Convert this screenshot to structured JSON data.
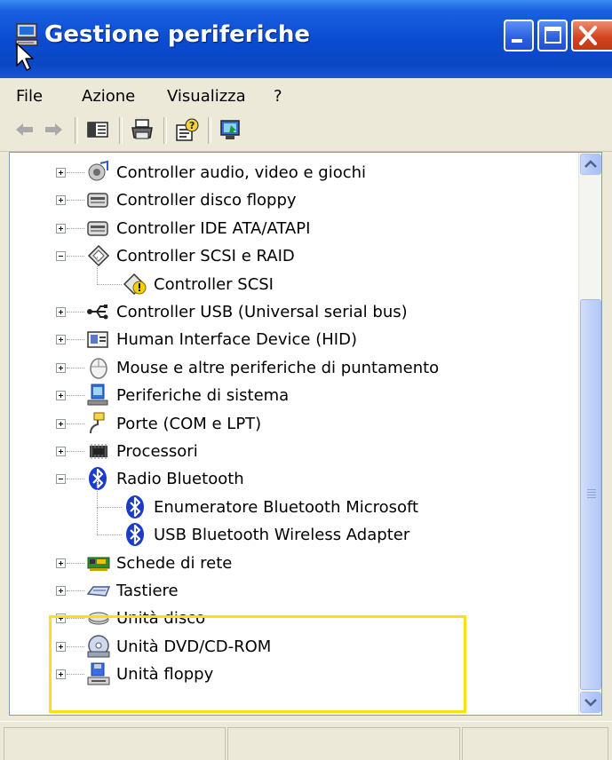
{
  "window": {
    "title": "Gestione periferiche"
  },
  "menu": [
    "File",
    "Azione",
    "Visualizza",
    "?"
  ],
  "toolbar": {
    "buttons": [
      "back-arrow-icon",
      "forward-arrow-icon",
      "show-hide-console-tree-icon",
      "print-icon",
      "help-icon",
      "properties-icon"
    ]
  },
  "tree": {
    "items": [
      {
        "label": "Controller audio, video e giochi",
        "expanded": false,
        "icon": "speaker-icon"
      },
      {
        "label": "Controller disco floppy",
        "expanded": false,
        "icon": "floppy-controller-icon"
      },
      {
        "label": "Controller IDE ATA/ATAPI",
        "expanded": false,
        "icon": "ide-controller-icon"
      },
      {
        "label": "Controller SCSI e RAID",
        "expanded": true,
        "icon": "scsi-icon"
      },
      {
        "label": "Controller SCSI",
        "child": true,
        "icon": "scsi-warning-icon"
      },
      {
        "label": "Controller USB (Universal serial bus)",
        "expanded": false,
        "icon": "usb-icon"
      },
      {
        "label": "Human Interface Device (HID)",
        "expanded": false,
        "icon": "hid-icon"
      },
      {
        "label": "Mouse e altre periferiche di puntamento",
        "expanded": false,
        "icon": "mouse-icon"
      },
      {
        "label": "Periferiche di sistema",
        "expanded": false,
        "icon": "system-device-icon"
      },
      {
        "label": "Porte (COM e LPT)",
        "expanded": false,
        "icon": "port-icon"
      },
      {
        "label": "Processori",
        "expanded": false,
        "icon": "processor-icon"
      },
      {
        "label": "Radio Bluetooth",
        "expanded": true,
        "icon": "bluetooth-icon"
      },
      {
        "label": "Enumeratore Bluetooth Microsoft",
        "child": true,
        "icon": "bluetooth-icon"
      },
      {
        "label": "USB Bluetooth Wireless Adapter",
        "child": true,
        "icon": "bluetooth-icon"
      },
      {
        "label": "Schede di rete",
        "expanded": false,
        "icon": "network-card-icon"
      },
      {
        "label": "Tastiere",
        "expanded": false,
        "icon": "keyboard-icon"
      },
      {
        "label": "Unità disco",
        "expanded": false,
        "icon": "disk-drive-icon"
      },
      {
        "label": "Unità DVD/CD-ROM",
        "expanded": false,
        "icon": "cdrom-icon"
      },
      {
        "label": "Unità floppy",
        "expanded": false,
        "icon": "floppy-drive-icon"
      }
    ]
  },
  "colors": {
    "highlight": "#f5e21a",
    "titlebar": "#0a4bd2"
  }
}
